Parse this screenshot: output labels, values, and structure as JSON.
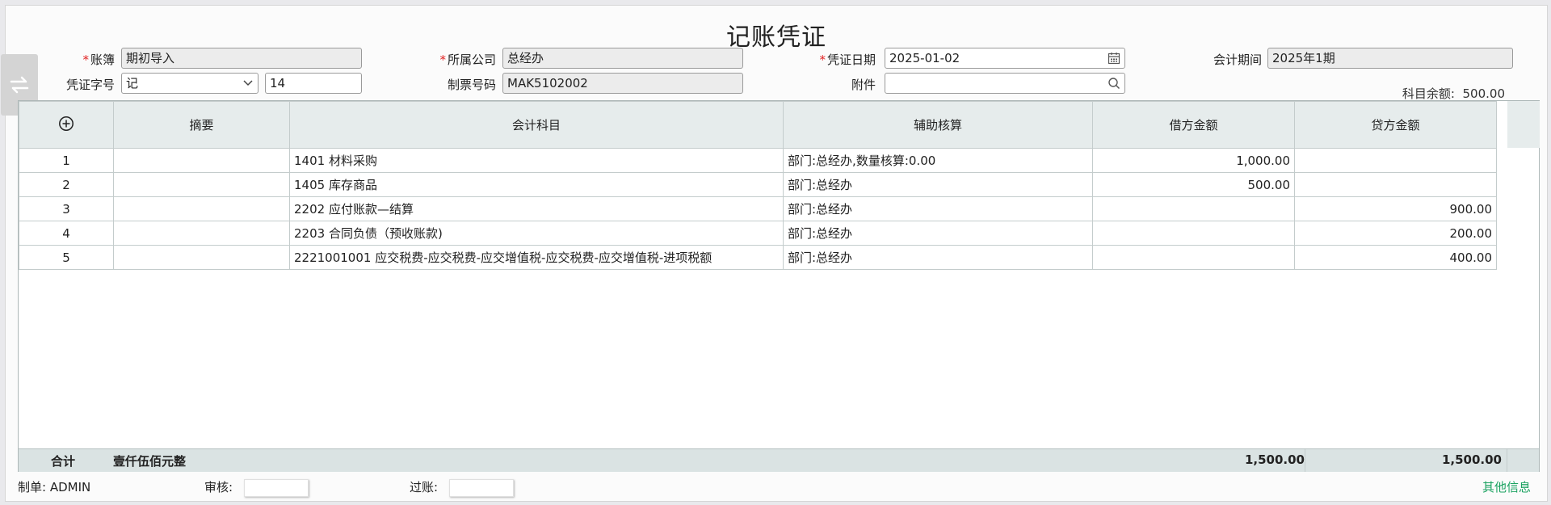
{
  "title": "记账凭证",
  "form": {
    "ledger_label": "账簿",
    "ledger_value": "期初导入",
    "company_label": "所属公司",
    "company_value": "总经办",
    "date_label": "凭证日期",
    "date_value": "2025-01-02",
    "period_label": "会计期间",
    "period_value": "2025年1期",
    "voucher_type_label": "凭证字号",
    "voucher_type_value": "记",
    "voucher_number_value": "14",
    "ticket_label": "制票号码",
    "ticket_value": "MAK5102002",
    "attachment_label": "附件",
    "attachment_value": "",
    "required_mark": "*",
    "balance_label": "科目余额:",
    "balance_value": "500.00"
  },
  "table": {
    "columns": [
      "摘要",
      "会计科目",
      "辅助核算",
      "借方金额",
      "贷方金额"
    ],
    "rows": [
      {
        "no": "1",
        "summary": "",
        "account": "1401 材料采购",
        "aux": "部门:总经办,数量核算:0.00",
        "debit": "1,000.00",
        "credit": ""
      },
      {
        "no": "2",
        "summary": "",
        "account": "1405 库存商品",
        "aux": "部门:总经办",
        "debit": "500.00",
        "credit": ""
      },
      {
        "no": "3",
        "summary": "",
        "account": "2202 应付账款—结算",
        "aux": "部门:总经办",
        "debit": "",
        "credit": "900.00"
      },
      {
        "no": "4",
        "summary": "",
        "account": "2203 合同负债（预收账款)",
        "aux": "部门:总经办",
        "debit": "",
        "credit": "200.00"
      },
      {
        "no": "5",
        "summary": "",
        "account": "2221001001 应交税费-应交税费-应交增值税-应交税费-应交增值税-进项税额",
        "aux": "部门:总经办",
        "debit": "",
        "credit": "400.00"
      }
    ],
    "total_label": "合计",
    "total_words": "壹仟伍佰元整",
    "total_debit": "1,500.00",
    "total_credit": "1,500.00"
  },
  "footer": {
    "maker_label": "制单:",
    "maker_value": "ADMIN",
    "audit_label": "审核:",
    "post_label": "过账:",
    "other_info": "其他信息"
  },
  "icons": [
    "swap-icon",
    "calendar-icon",
    "search-icon",
    "chevron-down-icon",
    "add-row-icon"
  ],
  "colors": {
    "accent_link": "#1aa260",
    "required": "#e02020",
    "header_bg": "#e6ecec",
    "total_bg": "#dae3e3"
  }
}
